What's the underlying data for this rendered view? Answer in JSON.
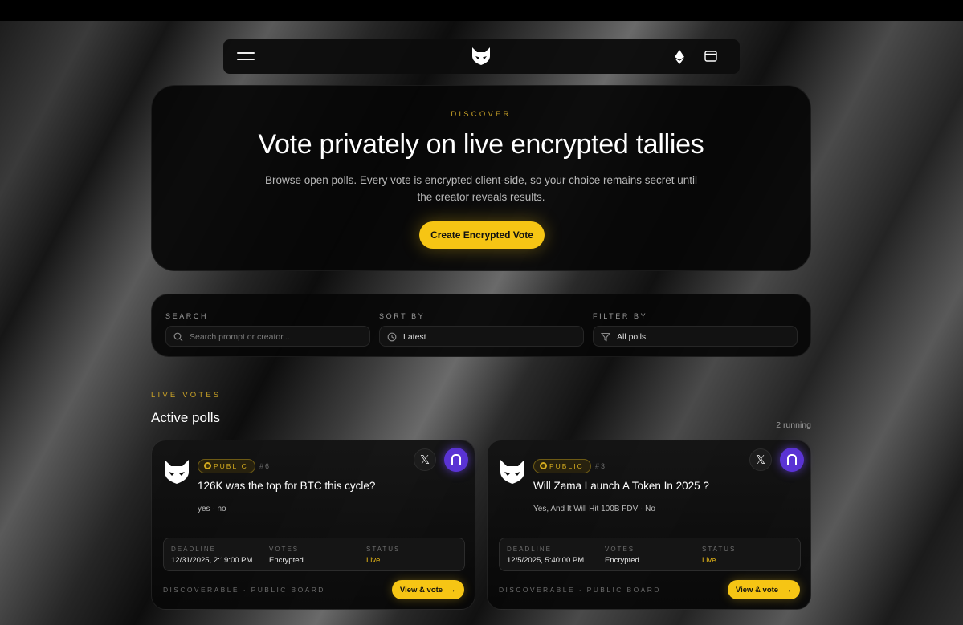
{
  "hero": {
    "eyebrow": "DISCOVER",
    "title": "Vote privately on live encrypted tallies",
    "description": "Browse open polls. Every vote is encrypted client-side, so your choice remains secret until the creator reveals results.",
    "cta_label": "Create Encrypted Vote"
  },
  "filters": {
    "search": {
      "label": "SEARCH",
      "placeholder": "Search prompt or creator..."
    },
    "sort": {
      "label": "SORT BY",
      "value": "Latest"
    },
    "filter": {
      "label": "FILTER BY",
      "value": "All polls"
    }
  },
  "section": {
    "eyebrow": "LIVE VOTES",
    "title": "Active polls",
    "count_label": "2 running"
  },
  "polls": [
    {
      "visibility": "PUBLIC",
      "number": "#6",
      "question": "126K was the top for BTC this cycle?",
      "options": "yes · no",
      "deadline_label": "DEADLINE",
      "deadline": "12/31/2025, 2:19:00 PM",
      "votes_label": "VOTES",
      "votes": "Encrypted",
      "status_label": "STATUS",
      "status": "Live",
      "footer": "DISCOVERABLE · PUBLIC BOARD",
      "action": "View & vote"
    },
    {
      "visibility": "PUBLIC",
      "number": "#3",
      "question": "Will Zama Launch A Token In 2025 ?",
      "options": "Yes, And It Will Hit 100B FDV · No",
      "deadline_label": "DEADLINE",
      "deadline": "12/5/2025, 5:40:00 PM",
      "votes_label": "VOTES",
      "votes": "Encrypted",
      "status_label": "STATUS",
      "status": "Live",
      "footer": "DISCOVERABLE · PUBLIC BOARD",
      "action": "View & vote"
    }
  ],
  "icons": {
    "x_glyph": "𝕏",
    "arrow_glyph": "→"
  },
  "colors": {
    "accent": "#f6c514",
    "zama_purple": "#5a33d4"
  }
}
